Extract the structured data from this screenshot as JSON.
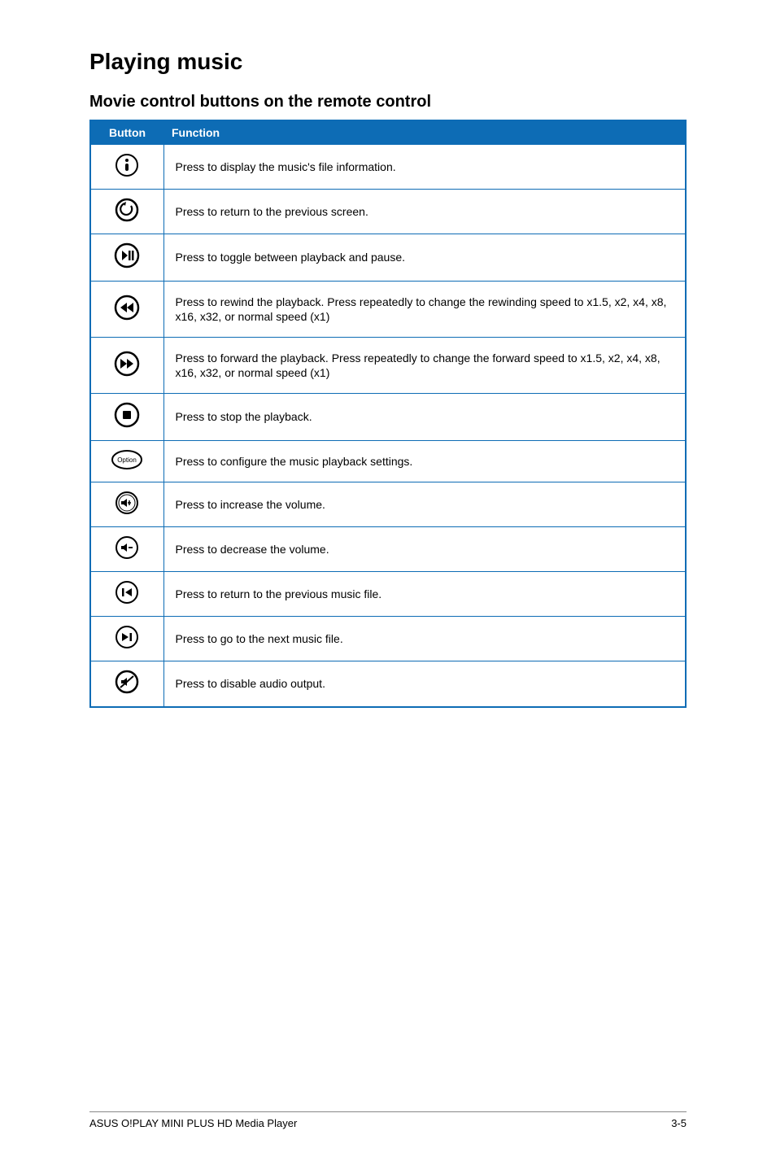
{
  "headings": {
    "title": "Playing music",
    "subtitle": "Movie control buttons on the remote control"
  },
  "table": {
    "header_button": "Button",
    "header_function": "Function",
    "rows": [
      {
        "icon": "info",
        "desc": "Press to display the music's file information."
      },
      {
        "icon": "return",
        "desc": "Press to return to the previous screen."
      },
      {
        "icon": "playpause",
        "desc": "Press to toggle between playback and pause."
      },
      {
        "icon": "rewind",
        "desc": "Press to rewind the playback. Press repeatedly to change the rewinding speed to x1.5, x2, x4, x8, x16, x32, or normal speed (x1)"
      },
      {
        "icon": "forward",
        "desc": "Press to forward the playback. Press repeatedly to change the forward speed to x1.5, x2, x4, x8, x16, x32, or normal speed (x1)"
      },
      {
        "icon": "stop",
        "desc": "Press to stop the playback."
      },
      {
        "icon": "option",
        "desc": "Press to configure the music playback settings."
      },
      {
        "icon": "volup",
        "desc": "Press to increase the volume."
      },
      {
        "icon": "voldown",
        "desc": "Press to decrease the volume."
      },
      {
        "icon": "prev",
        "desc": "Press to return to the previous music file."
      },
      {
        "icon": "next",
        "desc": "Press to go to the next music file."
      },
      {
        "icon": "mute",
        "desc": "Press to disable audio output."
      }
    ]
  },
  "footer": {
    "left": "ASUS O!PLAY MINI PLUS HD Media Player",
    "right": "3-5"
  }
}
